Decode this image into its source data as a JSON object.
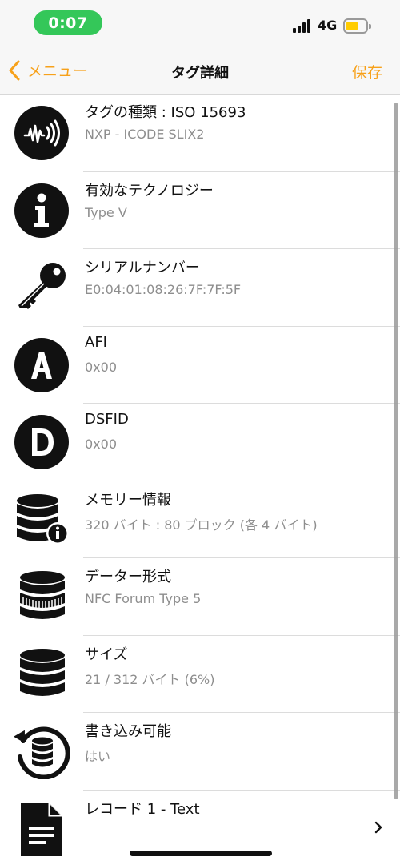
{
  "status_bar": {
    "time": "0:07",
    "network": "4G",
    "battery_color": "#ffcc00",
    "time_pill_color": "#34c759"
  },
  "nav": {
    "back_label": "メニュー",
    "title": "タグ詳細",
    "save_label": "保存",
    "accent_color": "#f7a11a"
  },
  "rows": [
    {
      "icon": "nfc-wave-icon",
      "title": "タグの種類 : ISO 15693",
      "subtitle": "NXP - ICODE SLIX2"
    },
    {
      "icon": "info-icon",
      "title": "有効なテクノロジー",
      "subtitle": "Type V"
    },
    {
      "icon": "key-icon",
      "title": "シリアルナンバー",
      "subtitle": "E0:04:01:08:26:7F:7F:5F"
    },
    {
      "icon": "letter-a-icon",
      "title": "AFI",
      "subtitle": "0x00"
    },
    {
      "icon": "letter-d-icon",
      "title": "DSFID",
      "subtitle": "0x00"
    },
    {
      "icon": "database-info-icon",
      "title": "メモリー情報",
      "subtitle": "320 バイト : 80 ブロック (各 4 バイト)"
    },
    {
      "icon": "database-format-icon",
      "title": "データー形式",
      "subtitle": "NFC Forum Type 5"
    },
    {
      "icon": "database-icon",
      "title": "サイズ",
      "subtitle": "21 / 312 バイト (6%)"
    },
    {
      "icon": "database-refresh-icon",
      "title": "書き込み可能",
      "subtitle": "はい"
    },
    {
      "icon": "document-icon",
      "title": "レコード 1 - Text",
      "subtitle": ""
    }
  ]
}
